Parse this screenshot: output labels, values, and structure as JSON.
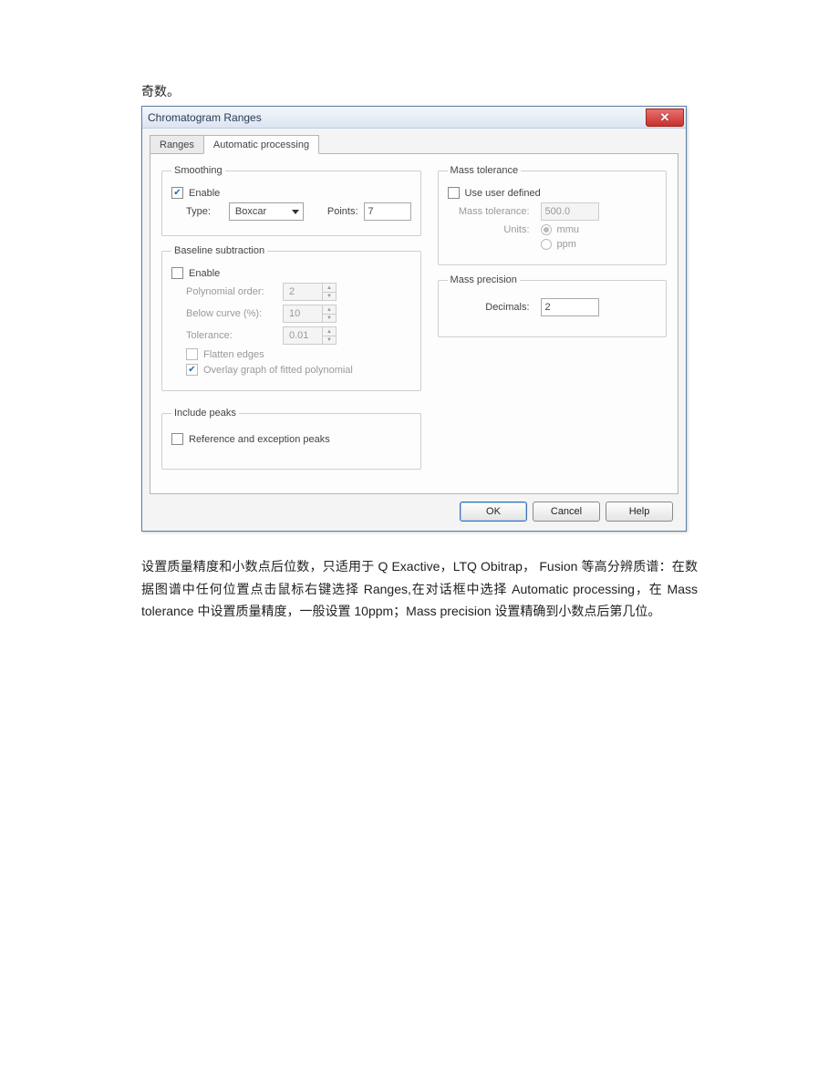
{
  "pre_text": "奇数。",
  "dialog": {
    "title": "Chromatogram Ranges",
    "tabs": {
      "ranges": "Ranges",
      "auto": "Automatic processing"
    },
    "smoothing": {
      "legend": "Smoothing",
      "enable_label": "Enable",
      "enable_checked": true,
      "type_label": "Type:",
      "type_value": "Boxcar",
      "points_label": "Points:",
      "points_value": "7"
    },
    "baseline": {
      "legend": "Baseline subtraction",
      "enable_label": "Enable",
      "enable_checked": false,
      "poly_label": "Polynomial order:",
      "poly_value": "2",
      "below_label": "Below curve (%):",
      "below_value": "10",
      "tol_label": "Tolerance:",
      "tol_value": "0.01",
      "flatten_label": "Flatten edges",
      "flatten_checked": false,
      "overlay_label": "Overlay graph of fitted polynomial",
      "overlay_checked": true
    },
    "include_peaks": {
      "legend": "Include peaks",
      "ref_label": "Reference and exception peaks",
      "ref_checked": false
    },
    "mass_tol": {
      "legend": "Mass tolerance",
      "user_label": "Use user defined",
      "user_checked": false,
      "tol_label": "Mass tolerance:",
      "tol_value": "500.0",
      "units_label": "Units:",
      "mmu": "mmu",
      "ppm": "ppm",
      "selected_unit": "mmu"
    },
    "mass_prec": {
      "legend": "Mass precision",
      "dec_label": "Decimals:",
      "dec_value": "2"
    },
    "buttons": {
      "ok": "OK",
      "cancel": "Cancel",
      "help": "Help"
    }
  },
  "post_text": "设置质量精度和小数点后位数，只适用于 Q Exactive，LTQ Obitrap，  Fusion 等高分辨质谱：在数据图谱中任何位置点击鼠标右键选择 Ranges,在对话框中选择 Automatic processing，在 Mass tolerance 中设置质量精度，一般设置 10ppm；Mass precision 设置精确到小数点后第几位。"
}
